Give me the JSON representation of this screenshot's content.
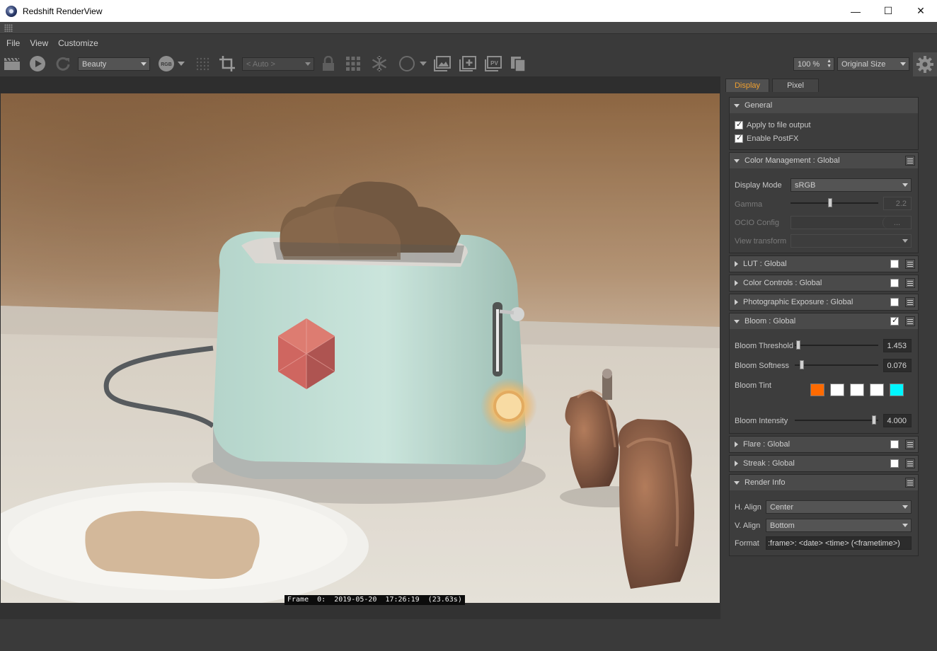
{
  "window": {
    "title": "Redshift RenderView",
    "minimize": "—",
    "maximize": "☐",
    "close": "✕"
  },
  "menu": [
    "File",
    "View",
    "Customize"
  ],
  "toolbar": {
    "aov_select": "Beauty",
    "rgb_badge": "RGB",
    "region_select": "< Auto >",
    "zoom_field": "100 %",
    "size_select": "Original Size",
    "pv_badge": "PV"
  },
  "render": {
    "frame_info": "Frame  0:  2019-05-20  17:26:19  (23.63s)"
  },
  "panel": {
    "tabs": [
      "Display",
      "Pixel"
    ],
    "general": {
      "title": "General",
      "apply_to_file_output": "Apply to file output",
      "enable_postfx": "Enable PostFX",
      "apply_checked": true,
      "enable_checked": true
    },
    "color_management": {
      "title": "Color Management  : Global",
      "display_mode_label": "Display Mode",
      "display_mode_value": "sRGB",
      "gamma_label": "Gamma",
      "gamma_value": "2.2",
      "gamma_level": 0.45,
      "ocio_label": "OCIO Config",
      "ocio_button": "...",
      "view_transform_label": "View transform",
      "view_transform_value": ""
    },
    "lut": {
      "title": "LUT  : Global",
      "checked": false
    },
    "color_controls": {
      "title": "Color Controls  : Global",
      "checked": false
    },
    "photographic_exposure": {
      "title": "Photographic Exposure  : Global",
      "checked": false
    },
    "bloom": {
      "title": "Bloom  : Global",
      "checked": true,
      "threshold_label": "Bloom Threshold",
      "threshold_value": "1.453",
      "threshold_level": 0.02,
      "softness_label": "Bloom Softness",
      "softness_value": "0.076",
      "softness_level": 0.06,
      "tint_label": "Bloom Tint",
      "tint_colors": [
        "#ff6a00",
        "#ffffff",
        "#ffffff",
        "#ffffff",
        "#00f6ff"
      ],
      "intensity_label": "Bloom Intensity",
      "intensity_value": "4.000",
      "intensity_level": 0.97
    },
    "flare": {
      "title": "Flare  : Global",
      "checked": false
    },
    "streak": {
      "title": "Streak  : Global",
      "checked": false
    },
    "render_info": {
      "title": "Render Info",
      "h_align_label": "H. Align",
      "h_align_value": "Center",
      "v_align_label": "V. Align",
      "v_align_value": "Bottom",
      "format_label": "Format",
      "format_value": ":frame>: <date> <time> (<frametime>)"
    }
  }
}
